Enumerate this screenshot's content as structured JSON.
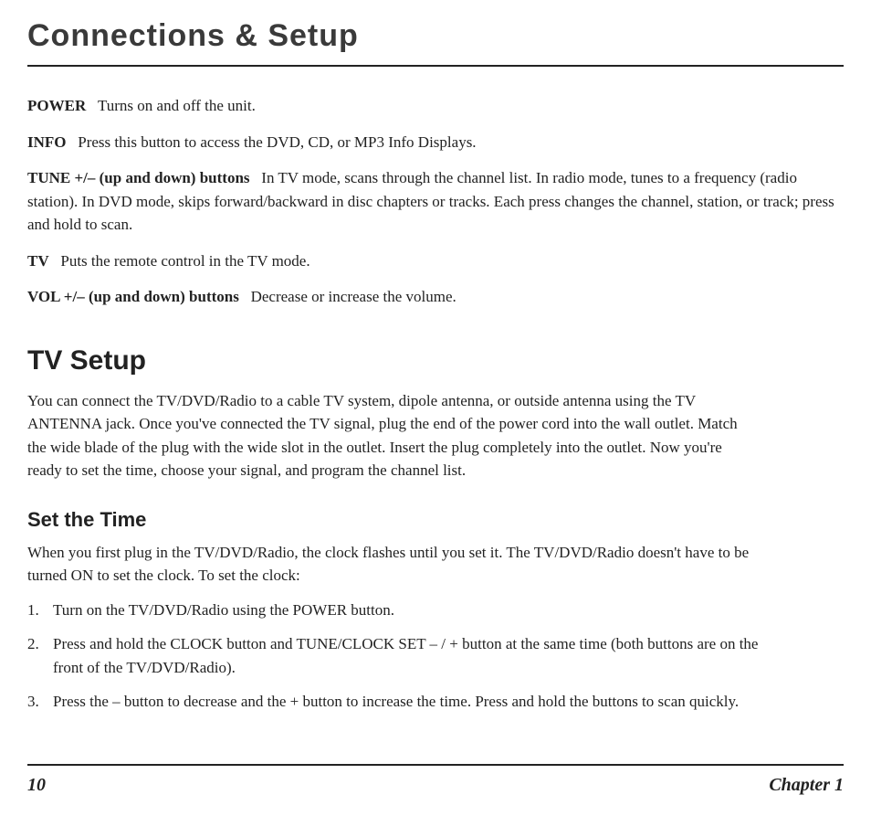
{
  "page_title": "Connections & Setup",
  "definitions": [
    {
      "term": "POWER",
      "desc": "Turns on and off the unit."
    },
    {
      "term": "INFO",
      "desc": "Press this button to access the DVD, CD, or MP3 Info Displays."
    },
    {
      "term": "TUNE +/– (up and down) buttons",
      "desc": "In TV mode, scans through the channel list. In radio mode, tunes to a frequency (radio station). In DVD mode, skips forward/backward in disc chapters or tracks.  Each press changes the channel, station, or track; press and hold to scan."
    },
    {
      "term": "TV",
      "desc": "Puts the remote control in the TV mode."
    },
    {
      "term": "VOL +/– (up and down) buttons",
      "desc": "Decrease or increase the volume."
    }
  ],
  "section": {
    "title": "TV Setup",
    "para": "You can connect the TV/DVD/Radio to a cable TV system, dipole antenna, or outside antenna using the TV ANTENNA jack. Once you've connected the TV signal, plug the end of the power cord into the wall outlet. Match the wide blade of the plug with the wide slot in the outlet. Insert the plug completely into the outlet. Now you're ready to set the time, choose your signal, and program the channel list."
  },
  "subsection": {
    "title": "Set the Time",
    "intro": "When you first plug in the TV/DVD/Radio, the clock flashes until you set it. The TV/DVD/Radio doesn't have to be turned ON to set the clock. To set the clock:",
    "steps": [
      "Turn on the TV/DVD/Radio using the POWER button.",
      "Press and hold the CLOCK button and TUNE/CLOCK SET – / + button at the same time (both buttons are on the front of the TV/DVD/Radio).",
      "Press the – button to decrease and the + button to increase the time.  Press and hold the buttons to scan quickly."
    ]
  },
  "footer": {
    "page_number": "10",
    "chapter": "Chapter 1"
  }
}
